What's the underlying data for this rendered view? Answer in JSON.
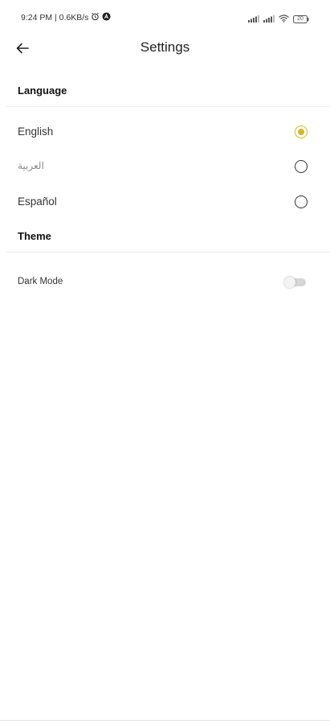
{
  "status_bar": {
    "time_speed": "9:24 PM | 0.6KB/s",
    "battery": "20"
  },
  "header": {
    "title": "Settings"
  },
  "language": {
    "section_title": "Language",
    "options": [
      {
        "label": "English",
        "selected": true
      },
      {
        "label": "العربية",
        "selected": false
      },
      {
        "label": "Español",
        "selected": false
      }
    ]
  },
  "theme": {
    "section_title": "Theme",
    "dark_mode_label": "Dark Mode",
    "dark_mode_on": false
  },
  "colors": {
    "accent": "#d4b728"
  }
}
